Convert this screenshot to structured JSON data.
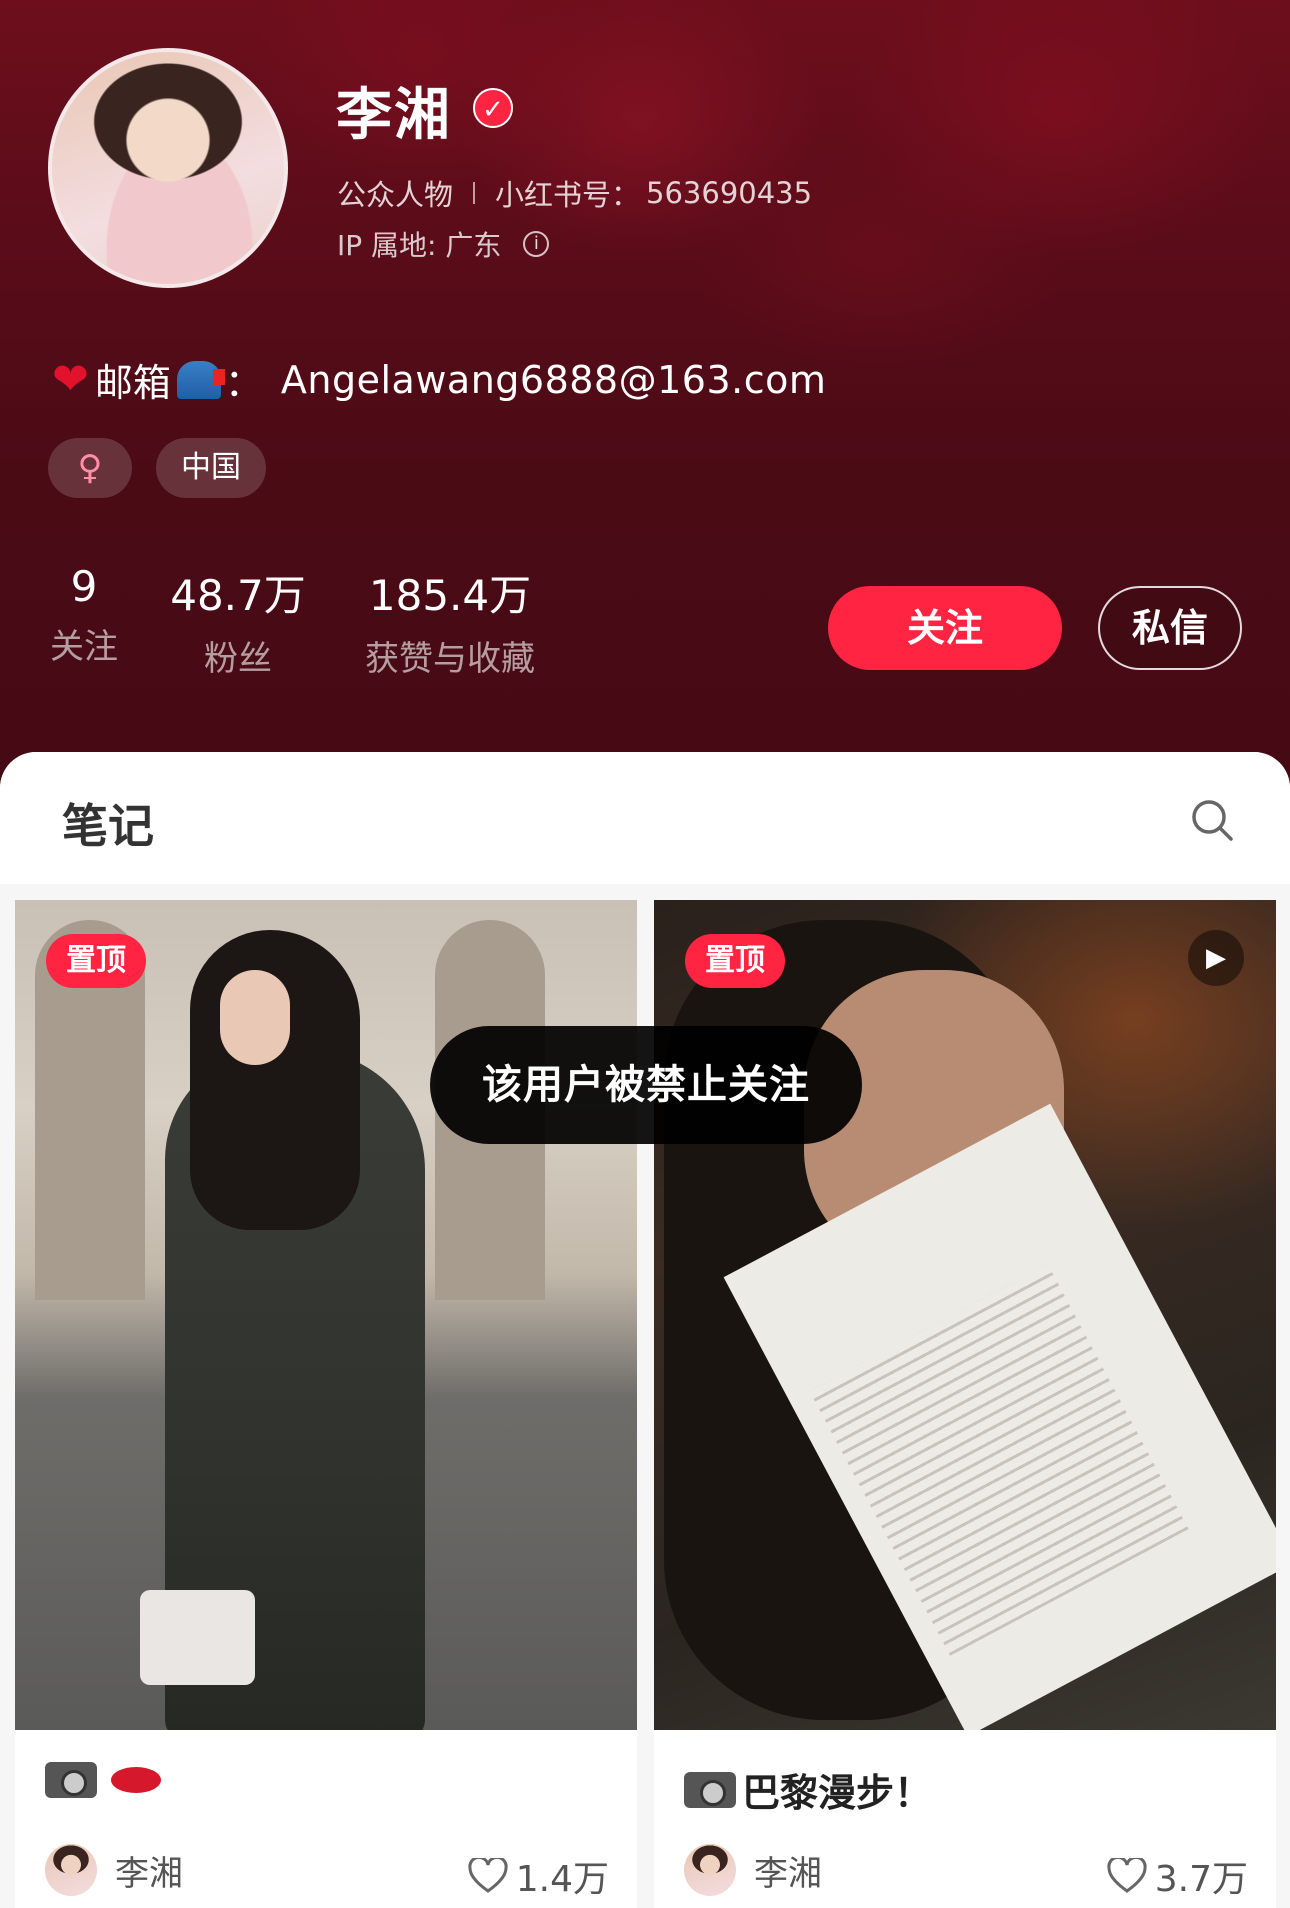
{
  "profile": {
    "name": "李湘",
    "category": "公众人物",
    "red_id_label": "小红书号：",
    "red_id": "563690435",
    "ip_label": "IP 属地: 广东",
    "bio_label": "邮箱",
    "bio_colon": "：",
    "bio_email": "Angelawang6888@163.com",
    "tags": {
      "gender": "♀",
      "region": "中国"
    }
  },
  "stats": [
    {
      "value": "9",
      "label": "关注"
    },
    {
      "value": "48.7万",
      "label": "粉丝"
    },
    {
      "value": "185.4万",
      "label": "获赞与收藏"
    }
  ],
  "actions": {
    "follow": "关注",
    "message": "私信"
  },
  "notes_tab": {
    "title": "笔记"
  },
  "notes": [
    {
      "pin": "置顶",
      "title": "",
      "author": "李湘",
      "likes": "1.4万",
      "has_video": false
    },
    {
      "pin": "置顶",
      "title": "巴黎漫步！",
      "author": "李湘",
      "likes": "3.7万",
      "has_video": true
    }
  ],
  "toast": "该用户被禁止关注",
  "colors": {
    "accent": "#ff2442",
    "header_bg": "#5a0c19"
  }
}
